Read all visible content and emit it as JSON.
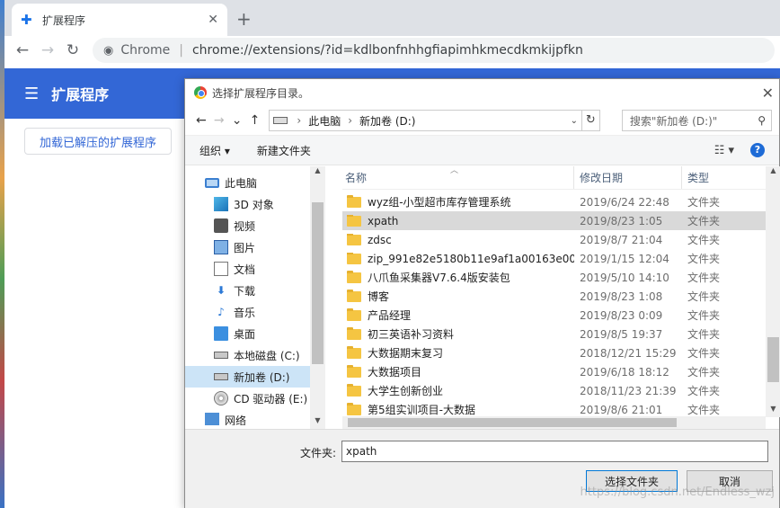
{
  "browser": {
    "tab_title": "扩展程序",
    "tab_icon": "puzzle-icon",
    "omnibox_chip": "Chrome",
    "omnibox_url": "chrome://extensions/?id=kdlbonfnhhgfiapimhkmecdkmkijpfkn"
  },
  "extensions_page": {
    "title": "扩展程序",
    "load_unpacked_label": "加载已解压的扩展程序",
    "accent_color": "#3367d6"
  },
  "dialog": {
    "title": "选择扩展程序目录。",
    "breadcrumb": [
      "此电脑",
      "新加卷 (D:)"
    ],
    "search_placeholder": "搜索\"新加卷 (D:)\"",
    "organize_label": "组织 ▾",
    "new_folder_label": "新建文件夹",
    "help_label": "?",
    "tree": [
      {
        "label": "此电脑",
        "icon": "computer-icon",
        "level": 0
      },
      {
        "label": "3D 对象",
        "icon": "3d-objects-icon",
        "level": 1
      },
      {
        "label": "视频",
        "icon": "video-icon",
        "level": 1
      },
      {
        "label": "图片",
        "icon": "pictures-icon",
        "level": 1
      },
      {
        "label": "文档",
        "icon": "documents-icon",
        "level": 1
      },
      {
        "label": "下载",
        "icon": "download-icon",
        "level": 1
      },
      {
        "label": "音乐",
        "icon": "music-icon",
        "level": 1
      },
      {
        "label": "桌面",
        "icon": "desktop-icon",
        "level": 1
      },
      {
        "label": "本地磁盘 (C:)",
        "icon": "drive-icon",
        "level": 1
      },
      {
        "label": "新加卷 (D:)",
        "icon": "drive-icon",
        "level": 1,
        "selected": true
      },
      {
        "label": "CD 驱动器 (E:)",
        "icon": "cd-drive-icon",
        "level": 1
      },
      {
        "label": "网络",
        "icon": "network-icon",
        "level": 0
      }
    ],
    "columns": {
      "name": "名称",
      "date": "修改日期",
      "type": "类型"
    },
    "files": [
      {
        "name": "wyz组-小型超市库存管理系统",
        "date": "2019/6/24 22:48",
        "type": "文件夹"
      },
      {
        "name": "xpath",
        "date": "2019/8/23 1:05",
        "type": "文件夹",
        "selected": true
      },
      {
        "name": "zdsc",
        "date": "2019/8/7 21:04",
        "type": "文件夹"
      },
      {
        "name": "zip_991e82e5180b11e9af1a00163e00...",
        "date": "2019/1/15 12:04",
        "type": "文件夹"
      },
      {
        "name": "八爪鱼采集器V7.6.4版安装包",
        "date": "2019/5/10 14:10",
        "type": "文件夹"
      },
      {
        "name": "博客",
        "date": "2019/8/23 1:08",
        "type": "文件夹"
      },
      {
        "name": "产品经理",
        "date": "2019/8/23 0:09",
        "type": "文件夹"
      },
      {
        "name": "初三英语补习资料",
        "date": "2019/8/5 19:37",
        "type": "文件夹"
      },
      {
        "name": "大数据期末复习",
        "date": "2018/12/21 15:29",
        "type": "文件夹"
      },
      {
        "name": "大数据项目",
        "date": "2019/6/18 18:12",
        "type": "文件夹"
      },
      {
        "name": "大学生创新创业",
        "date": "2018/11/23 21:39",
        "type": "文件夹"
      },
      {
        "name": "第5组实训项目-大数据",
        "date": "2019/8/6 21:01",
        "type": "文件夹"
      }
    ],
    "folder_label": "文件夹:",
    "folder_value": "xpath",
    "select_button": "选择文件夹",
    "cancel_button": "取消"
  },
  "watermark": "https://blog.csdn.net/Endless_wzj"
}
